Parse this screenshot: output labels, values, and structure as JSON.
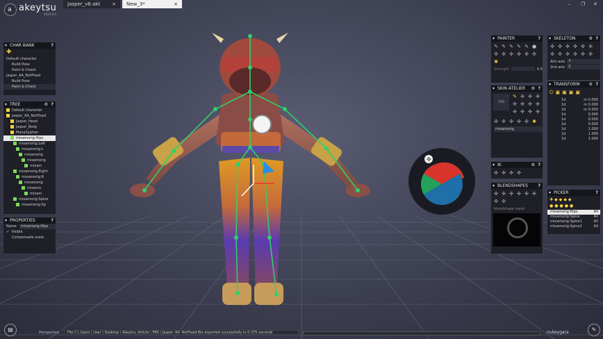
{
  "app": {
    "logo_letter": "a",
    "name": "akeytsu",
    "version": "2024.4.0"
  },
  "tabs": [
    {
      "label": "Jasper_v8.akt",
      "close": "×"
    },
    {
      "label": "New_3*",
      "close": "×"
    }
  ],
  "window": {
    "minimize": "–",
    "restore": "❐",
    "close": "✕"
  },
  "char_bank": {
    "title": "CHAR BANK",
    "help": "?",
    "items": [
      {
        "label": "Default character"
      },
      {
        "label": "Build Pose"
      },
      {
        "label": "Paint & Check"
      },
      {
        "label": "Jasper_AA_NotFixed"
      },
      {
        "label": "Build Pose"
      },
      {
        "label": "Paint & Check"
      }
    ]
  },
  "tree": {
    "title": "TREE",
    "help": "?",
    "items": [
      "Default character",
      "Jasper_AA_NotFixed",
      "Jasper_Head",
      "Jasper_Body",
      "ManaSyphon",
      "mixamorig:Hips",
      "mixamorig:Left",
      "mixamorig:L",
      "mixamorig",
      "mixamorig",
      "mixam",
      "mixamorig:Right",
      "mixamorig:R",
      "mixamorig",
      "mixamo",
      "mixam",
      "mixamorig:Spine",
      "mixamorig:Sp"
    ]
  },
  "properties": {
    "title": "PROPERTIES",
    "help": "?",
    "name_label": "Name",
    "name_value": "mixamorig:Hips",
    "visible_label": "Visible",
    "compensate_label": "Compensate scale",
    "check": "✓"
  },
  "painter": {
    "title": "PAINTER",
    "help": "?",
    "strength_label": "Strength",
    "value": "0.5"
  },
  "skin_atelier": {
    "title": "SKIN ATELIER",
    "help": "?",
    "field_value": "mixamorig",
    "readout": "100"
  },
  "ik": {
    "title": "IK",
    "help": "?"
  },
  "blendshapes": {
    "title": "BLENDSHAPES",
    "help": "?",
    "dropdown": "blendshape mesh"
  },
  "skeleton": {
    "title": "SKELETON",
    "help": "?",
    "axis1": "Aim axis",
    "axis1_val": "X",
    "axis2": "2nd axis",
    "axis2_val": "Z"
  },
  "transform": {
    "title": "TRANSFORM",
    "help": "?",
    "rows": [
      {
        "k": "1d",
        "v": "m 0.000"
      },
      {
        "k": "1d",
        "v": "m 0.000"
      },
      {
        "k": "1d",
        "v": "m 0.000"
      },
      {
        "k": "1d",
        "v": "0.000"
      },
      {
        "k": "1d",
        "v": "0.000"
      },
      {
        "k": "1d",
        "v": "0.000"
      },
      {
        "k": "1d",
        "v": "1.000"
      },
      {
        "k": "1d",
        "v": "1.000"
      },
      {
        "k": "1d",
        "v": "1.000"
      }
    ]
  },
  "picker": {
    "title": "PICKER",
    "help": "?",
    "items": [
      {
        "label": "mixamorig:Hips",
        "tag": "All"
      },
      {
        "label": "mixamorig:Spine",
        "tag": "All"
      },
      {
        "label": "mixamorig:Spine1",
        "tag": "All"
      },
      {
        "label": "mixamorig:Spine2",
        "tag": "All"
      }
    ]
  },
  "viewport": {
    "view_label": "Perspective"
  },
  "status": {
    "message": "File C:\\ Users \\ User \\ Desktop \\ Akeytsu_Article \\ FBX \\ Jasper_AA_NotFixed.fbx exported successfully in 0.375 seconds",
    "brand": "nukeygara"
  },
  "colors": {
    "accent": "#7ed957",
    "joint": "#33cc66",
    "red": "#d9342b",
    "green": "#23a15a",
    "blue": "#1f6fa8"
  },
  "icons": [
    "folder-icon",
    "key-icon",
    "help-icon",
    "gear-icon",
    "eye-icon",
    "wrench-icon"
  ]
}
